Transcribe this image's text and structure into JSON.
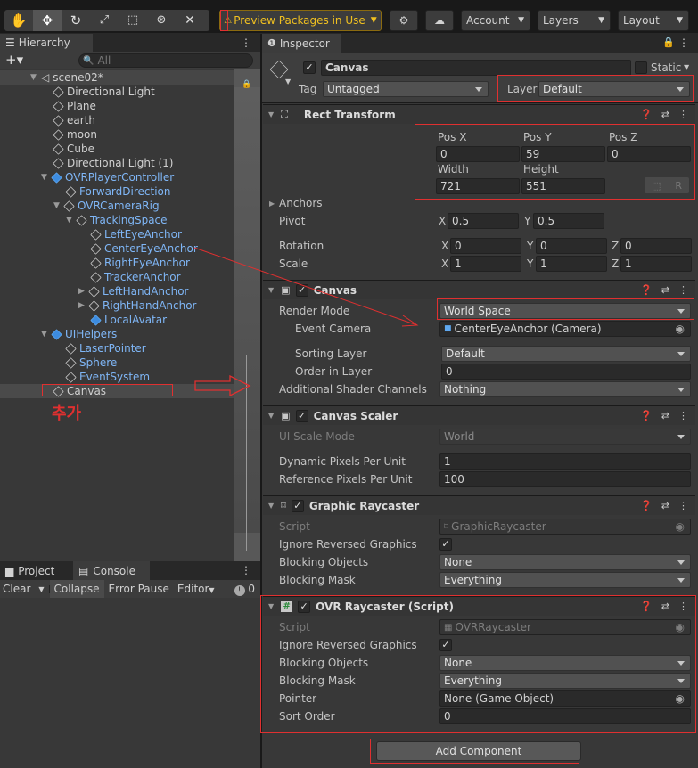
{
  "toolbar": {
    "preview_label": "Preview Packages in Use",
    "account": "Account",
    "layers": "Layers",
    "layout": "Layout"
  },
  "hierarchy": {
    "tab": "Hierarchy",
    "search_placeholder": "All",
    "scene": "scene02*",
    "items": [
      {
        "label": "Directional Light"
      },
      {
        "label": "Plane"
      },
      {
        "label": "earth"
      },
      {
        "label": "moon"
      },
      {
        "label": "Cube"
      },
      {
        "label": "Directional Light (1)"
      },
      {
        "label": "OVRPlayerController"
      },
      {
        "label": "ForwardDirection"
      },
      {
        "label": "OVRCameraRig"
      },
      {
        "label": "TrackingSpace"
      },
      {
        "label": "LeftEyeAnchor"
      },
      {
        "label": "CenterEyeAnchor"
      },
      {
        "label": "RightEyeAnchor"
      },
      {
        "label": "TrackerAnchor"
      },
      {
        "label": "LeftHandAnchor"
      },
      {
        "label": "RightHandAnchor"
      },
      {
        "label": "LocalAvatar"
      },
      {
        "label": "UIHelpers"
      },
      {
        "label": "LaserPointer"
      },
      {
        "label": "Sphere"
      },
      {
        "label": "EventSystem"
      },
      {
        "label": "Canvas"
      }
    ],
    "annotation": "추가"
  },
  "console": {
    "tab_project": "Project",
    "tab_console": "Console",
    "clear": "Clear",
    "collapse": "Collapse",
    "error_pause": "Error Pause",
    "editor": "Editor",
    "count": "0"
  },
  "inspector": {
    "tab": "Inspector",
    "object_name": "Canvas",
    "static_label": "Static",
    "tag_label": "Tag",
    "tag_value": "Untagged",
    "layer_label": "Layer",
    "layer_value": "Default",
    "rect_transform": {
      "title": "Rect Transform",
      "pos_x_label": "Pos X",
      "pos_x": "0",
      "pos_y_label": "Pos Y",
      "pos_y": "59",
      "pos_z_label": "Pos Z",
      "pos_z": "0",
      "width_label": "Width",
      "width": "721",
      "height_label": "Height",
      "height": "551",
      "r_label": "R",
      "anchors": "Anchors",
      "pivot": "Pivot",
      "pivot_x": "0.5",
      "pivot_y": "0.5",
      "rotation": "Rotation",
      "rot_x": "0",
      "rot_y": "0",
      "rot_z": "0",
      "scale": "Scale",
      "scale_x": "1",
      "scale_y": "1",
      "scale_z": "1",
      "x": "X",
      "y": "Y",
      "z": "Z"
    },
    "canvas": {
      "title": "Canvas",
      "render_mode_label": "Render Mode",
      "render_mode": "World Space",
      "event_camera_label": "Event Camera",
      "event_camera": "CenterEyeAnchor (Camera)",
      "sorting_layer_label": "Sorting Layer",
      "sorting_layer": "Default",
      "order_label": "Order in Layer",
      "order": "0",
      "shader_label": "Additional Shader Channels",
      "shader": "Nothing"
    },
    "canvas_scaler": {
      "title": "Canvas Scaler",
      "mode_label": "UI Scale Mode",
      "mode": "World",
      "dyn_label": "Dynamic Pixels Per Unit",
      "dyn": "1",
      "ref_label": "Reference Pixels Per Unit",
      "ref": "100"
    },
    "graphic_raycaster": {
      "title": "Graphic Raycaster",
      "script_label": "Script",
      "script": "GraphicRaycaster",
      "ignore_label": "Ignore Reversed Graphics",
      "blocking_label": "Blocking Objects",
      "blocking": "None",
      "mask_label": "Blocking Mask",
      "mask": "Everything"
    },
    "ovr_raycaster": {
      "title": "OVR Raycaster (Script)",
      "script_label": "Script",
      "script": "OVRRaycaster",
      "ignore_label": "Ignore Reversed Graphics",
      "blocking_label": "Blocking Objects",
      "blocking": "None",
      "mask_label": "Blocking Mask",
      "mask": "Everything",
      "pointer_label": "Pointer",
      "pointer": "None (Game Object)",
      "sort_label": "Sort Order",
      "sort": "0"
    },
    "add_component": "Add Component"
  },
  "colors": {
    "accent_red": "#e03030",
    "hier_blue": "#7fb6f6",
    "preview_yellow": "#f0c020"
  }
}
